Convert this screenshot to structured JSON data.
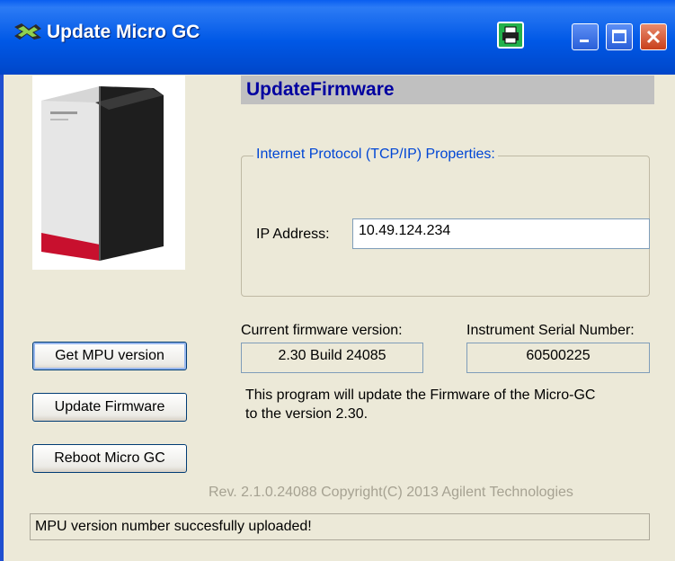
{
  "window": {
    "title": "Update Micro GC"
  },
  "header": {
    "title": "UpdateFirmware"
  },
  "tcpip": {
    "legend": "Internet Protocol (TCP/IP) Properties:",
    "ip_label": "IP Address:",
    "ip_value": "10.49.124.234"
  },
  "firmware": {
    "label": "Current firmware version:",
    "value": "2.30 Build 24085"
  },
  "serial": {
    "label": "Instrument Serial Number:",
    "value": "60500225"
  },
  "buttons": {
    "get_mpu": "Get MPU version",
    "update": "Update Firmware",
    "reboot": "Reboot Micro GC"
  },
  "message": {
    "line1": "This program will update the Firmware of the Micro-GC",
    "line2": "to the version 2.30."
  },
  "copyright": "Rev. 2.1.0.24088   Copyright(C) 2013  Agilent Technologies",
  "status": "MPU version number succesfully uploaded!",
  "icons": [
    "app-icon",
    "print-icon",
    "minimize-icon",
    "maximize-icon",
    "close-icon"
  ],
  "colors": {
    "titlebar": "#0058E6",
    "window_bg": "#ECE9D8",
    "header_text": "#0000A0",
    "legend_text": "#0046D5",
    "print_button": "#22B14C"
  }
}
